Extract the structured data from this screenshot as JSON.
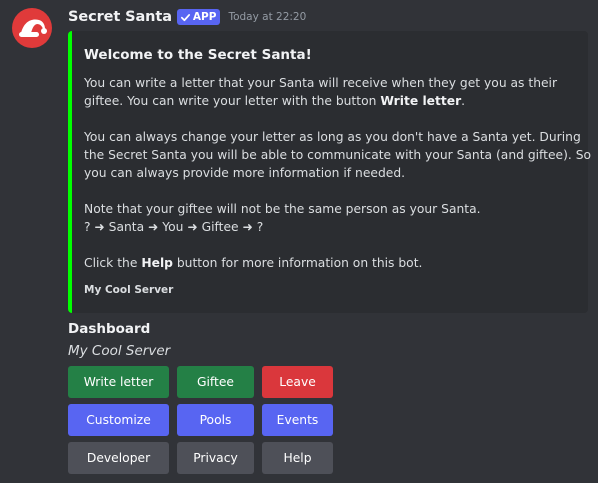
{
  "message": {
    "author": "Secret Santa",
    "tag": "APP",
    "timestamp": "Today at 22:20",
    "avatar_icon": "santa-hat-icon"
  },
  "embed": {
    "accent_color": "#00ff00",
    "title": "Welcome to the Secret Santa!",
    "paragraphs": [
      [
        {
          "text": "You can write a letter that your Santa will receive when they get you as their"
        },
        {
          "text": "giftee. You can write your letter with the button "
        },
        {
          "bold": "Write letter"
        },
        {
          "text": "."
        }
      ],
      [
        {
          "text": "You can always change your letter as long as you don't have a Santa yet. During"
        },
        {
          "text": "the Secret Santa you will be able to communicate with your Santa (and giftee). So"
        },
        {
          "text": "you can always provide more information if needed."
        }
      ],
      [
        {
          "text": "Note that your giftee will not be the same person as your Santa."
        },
        {
          "text": "? ➜ Santa ➜ You ➜ Giftee ➜ ?"
        }
      ],
      [
        {
          "text": "Click the "
        },
        {
          "bold": "Help"
        },
        {
          "text": " button for more information on this bot."
        }
      ]
    ],
    "footer": "My Cool Server"
  },
  "dashboard": {
    "title": "Dashboard",
    "subtitle": "My Cool Server"
  },
  "buttons": {
    "write_letter": "Write letter",
    "giftee": "Giftee",
    "leave": "Leave",
    "customize": "Customize",
    "pools": "Pools",
    "events": "Events",
    "developer": "Developer",
    "privacy": "Privacy",
    "help": "Help"
  },
  "colors": {
    "background": "#313338",
    "embed_background": "#2b2d31",
    "button_success": "#248046",
    "button_danger": "#da373c",
    "button_primary": "#5865f2",
    "button_secondary": "#4e5058",
    "app_tag": "#5865f2",
    "avatar": "#e03a3a"
  }
}
